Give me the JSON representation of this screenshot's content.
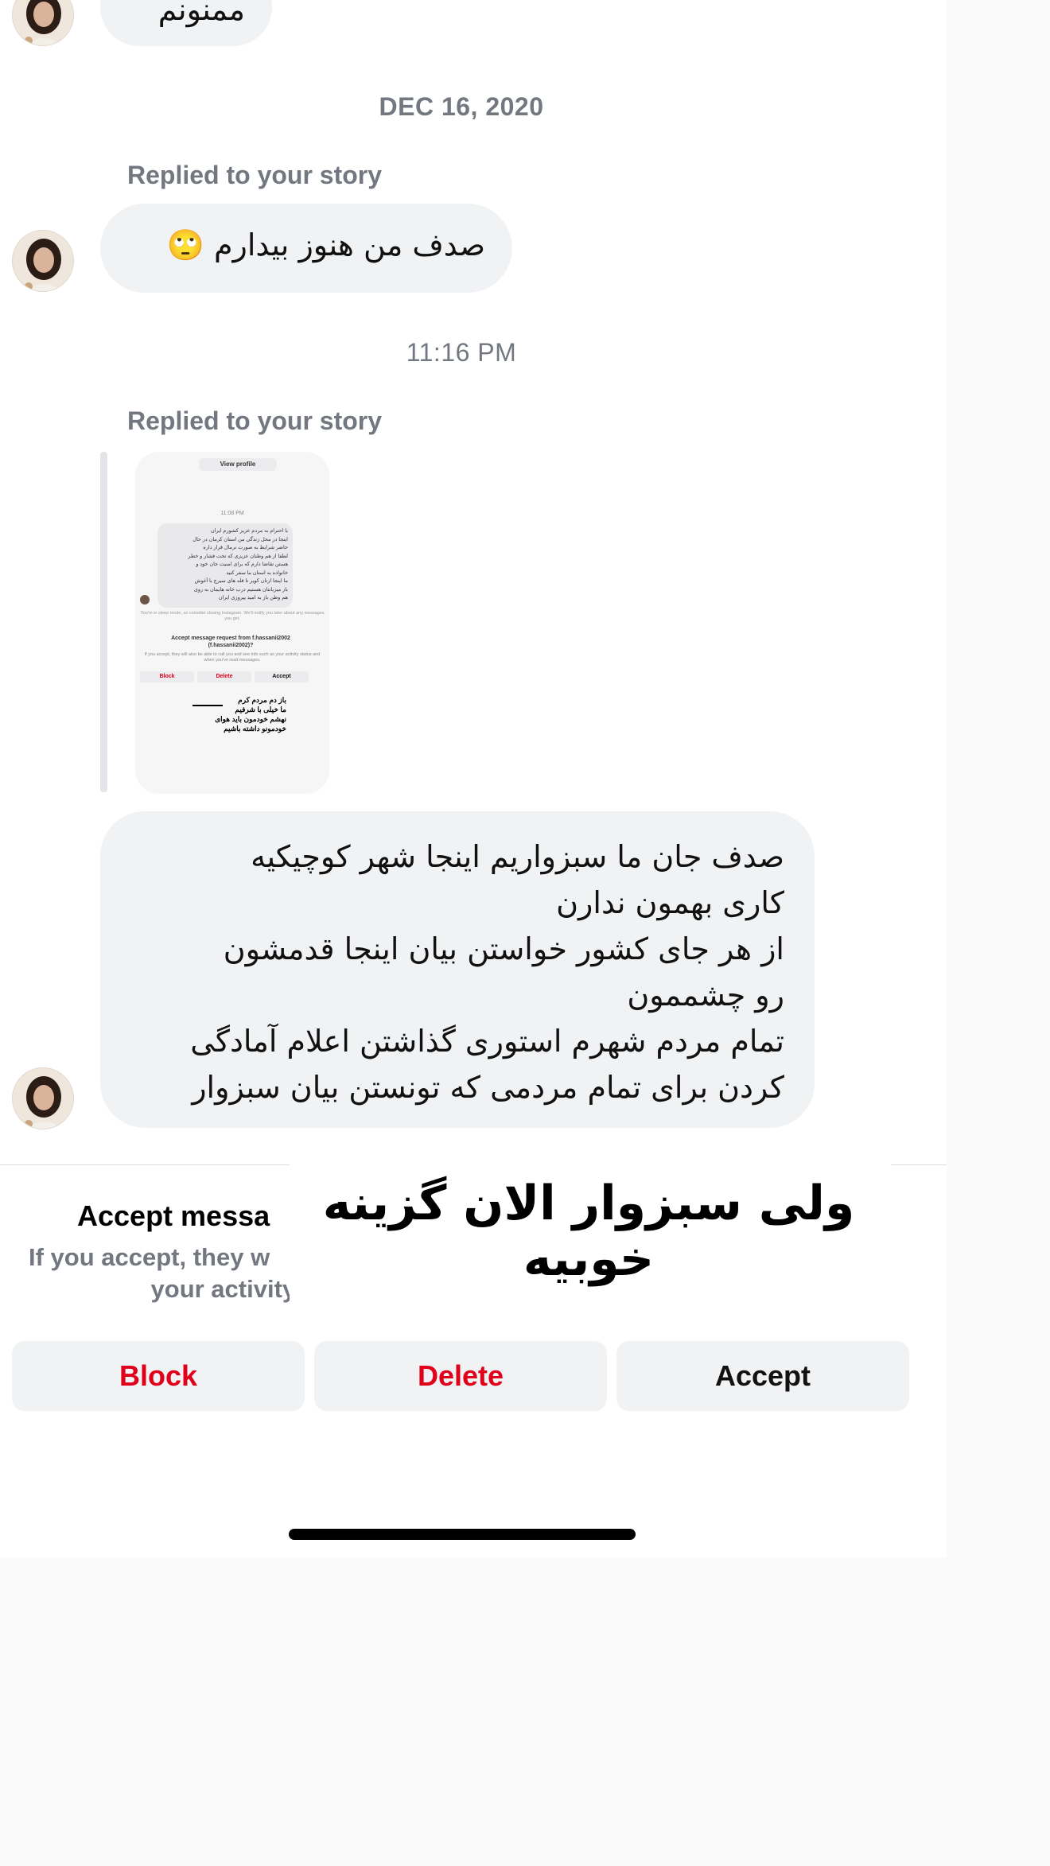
{
  "messages": {
    "top_bubble_text": "ممنونم",
    "date_label": "DEC 16, 2020",
    "reply_label_1": "Replied to your story",
    "bubble_1_text": "صدف من هنوز بیدارم 🙄",
    "time_label": "11:16 PM",
    "reply_label_2": "Replied to your story",
    "bubble_2_lines": [
      "صدف جان ما سبزواریم اینجا شهر کوچیکیه",
      "کاری بهمون ندارن",
      "از هر جای کشور خواستن بیان اینجا قدمشون",
      "رو چشممون",
      "تمام مردم شهرم استوری گذاشتن اعلام آمادگی",
      "کردن برای تمام مردمی که تونستن بیان سبزوار"
    ]
  },
  "story_preview": {
    "view_profile": "View profile",
    "time": "11:08 PM",
    "message_lines": [
      "با احترام به مردم عزیز کشورم ایران",
      "اینجا در محل زندگی من استان کرمان در حال",
      "حاضر شرایط به صورت نرمال قرار داره",
      "لطفا از هم وطنان عزیزی که تحت فشار و خطر",
      "هستن تقاضا دارم که برای امنیت جان خود و",
      "خانواده به استان ما سفر کنید",
      "ما اینجا ازتان کویر تا قله های سیرچ با آغوش",
      "باز میزبانتان هستیم درب خانه هایمان به روی",
      "هم وطن باز به امید پیروزی ایران"
    ],
    "sleep_note": "You're in sleep mode, so consider closing Instagram. We'll notify you later about any messages you get.",
    "accept_title": "Accept message request from f.hassanii2002 (f.hassanii2002)?",
    "accept_desc": "If you accept, they will also be able to call you and see info such as your activity status and when you've read messages.",
    "block": "Block",
    "delete": "Delete",
    "accept": "Accept",
    "caption_lines": [
      "باز دم مردم کرم",
      "ما خیلی با شرفیم",
      "نهشم خودمون باید هوای",
      "خودمونو داشته باشیم"
    ]
  },
  "overlay_text": "ولی سبزوار الان گزینه خوبیه",
  "request_sheet": {
    "title": "Accept messa",
    "desc_line1": "If you accept, they w",
    "desc_line2": "your activity status and when you've read messages.",
    "block_label": "Block",
    "delete_label": "Delete",
    "accept_label": "Accept"
  },
  "colors": {
    "danger": "#e0001a",
    "bubble": "#f1f2f4",
    "muted": "#737780"
  }
}
